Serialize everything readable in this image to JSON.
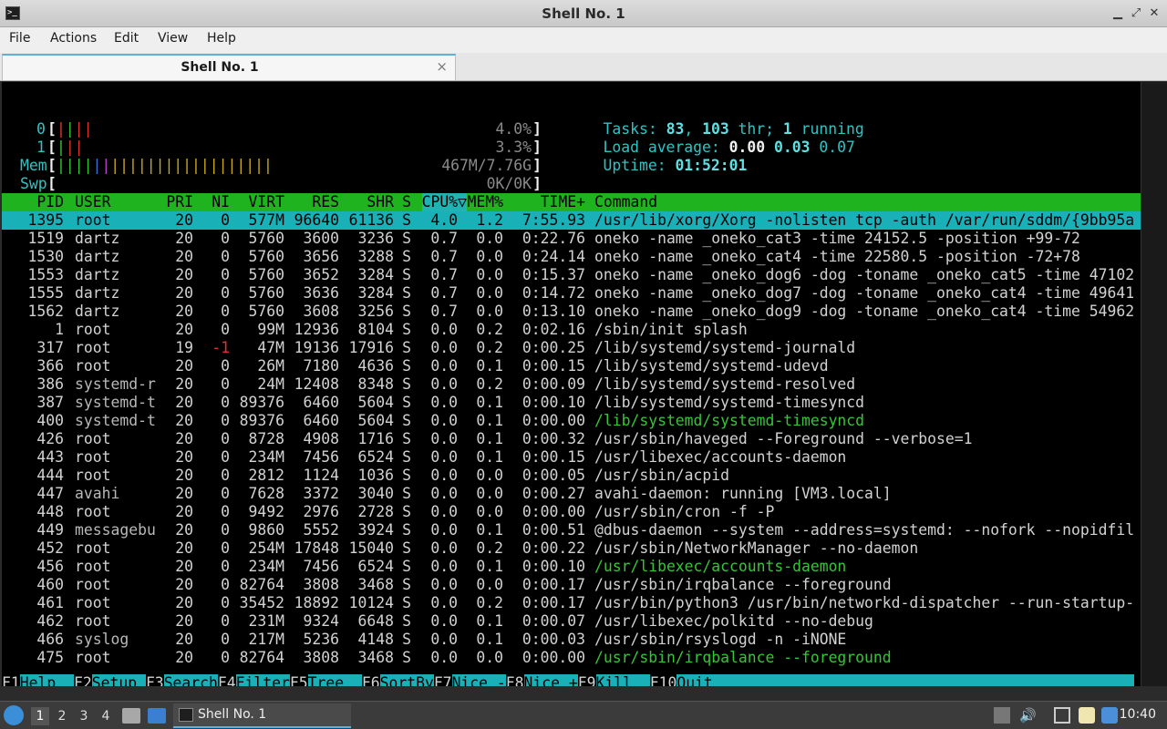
{
  "window": {
    "title": "Shell No. 1"
  },
  "menu": [
    "File",
    "Actions",
    "Edit",
    "View",
    "Help"
  ],
  "tab": {
    "label": "Shell No. 1",
    "close": "×"
  },
  "meters": {
    "cpu0": {
      "label": "0",
      "value": "4.0%"
    },
    "cpu1": {
      "label": "1",
      "value": "3.3%"
    },
    "mem": {
      "label": "Mem",
      "value": "467M/7.76G"
    },
    "swp": {
      "label": "Swp",
      "value": "0K/0K"
    }
  },
  "summary": {
    "tasks_label": "Tasks:",
    "tasks": "83",
    "thr": "103",
    "thr_label": "thr;",
    "running": "1",
    "running_label": "running",
    "load_label": "Load average:",
    "load1": "0.00",
    "load5": "0.03",
    "load15": "0.07",
    "uptime_label": "Uptime:",
    "uptime": "01:52:01"
  },
  "columns": [
    "PID",
    "USER",
    "PRI",
    "NI",
    "VIRT",
    "RES",
    "SHR",
    "S",
    "CPU%▽",
    "MEM%",
    "TIME+",
    "Command"
  ],
  "processes": [
    {
      "pid": "1395",
      "user": "root",
      "pri": "20",
      "ni": "0",
      "virt": "577M",
      "res": "96640",
      "shr": "61136",
      "s": "S",
      "cpu": "4.0",
      "mem": "1.2",
      "time": "7:55.93",
      "cmd": "/usr/lib/xorg/Xorg -nolisten tcp -auth /var/run/sddm/{9bb95a"
    },
    {
      "pid": "1519",
      "user": "dartz",
      "pri": "20",
      "ni": "0",
      "virt": "5760",
      "res": "3600",
      "shr": "3236",
      "s": "S",
      "cpu": "0.7",
      "mem": "0.0",
      "time": "0:22.76",
      "cmd": "oneko -name _oneko_cat3 -time 24152.5 -position +99-72"
    },
    {
      "pid": "1530",
      "user": "dartz",
      "pri": "20",
      "ni": "0",
      "virt": "5760",
      "res": "3656",
      "shr": "3288",
      "s": "S",
      "cpu": "0.7",
      "mem": "0.0",
      "time": "0:24.14",
      "cmd": "oneko -name _oneko_cat4 -time 22580.5 -position -72+78"
    },
    {
      "pid": "1553",
      "user": "dartz",
      "pri": "20",
      "ni": "0",
      "virt": "5760",
      "res": "3652",
      "shr": "3284",
      "s": "S",
      "cpu": "0.7",
      "mem": "0.0",
      "time": "0:15.37",
      "cmd": "oneko -name _oneko_dog6 -dog -toname _oneko_cat5 -time 47102"
    },
    {
      "pid": "1555",
      "user": "dartz",
      "pri": "20",
      "ni": "0",
      "virt": "5760",
      "res": "3636",
      "shr": "3284",
      "s": "S",
      "cpu": "0.7",
      "mem": "0.0",
      "time": "0:14.72",
      "cmd": "oneko -name _oneko_dog7 -dog -toname _oneko_cat4 -time 49641"
    },
    {
      "pid": "1562",
      "user": "dartz",
      "pri": "20",
      "ni": "0",
      "virt": "5760",
      "res": "3608",
      "shr": "3256",
      "s": "S",
      "cpu": "0.7",
      "mem": "0.0",
      "time": "0:13.10",
      "cmd": "oneko -name _oneko_dog9 -dog -toname _oneko_cat4 -time 54962"
    },
    {
      "pid": "1",
      "user": "root",
      "pri": "20",
      "ni": "0",
      "virt": "99M",
      "res": "12936",
      "shr": "8104",
      "s": "S",
      "cpu": "0.0",
      "mem": "0.2",
      "time": "0:02.16",
      "cmd": "/sbin/init splash"
    },
    {
      "pid": "317",
      "user": "root",
      "pri": "19",
      "ni": "-1",
      "virt": "47M",
      "res": "19136",
      "shr": "17916",
      "s": "S",
      "cpu": "0.0",
      "mem": "0.2",
      "time": "0:00.25",
      "cmd": "/lib/systemd/systemd-journald"
    },
    {
      "pid": "366",
      "user": "root",
      "pri": "20",
      "ni": "0",
      "virt": "26M",
      "res": "7180",
      "shr": "4636",
      "s": "S",
      "cpu": "0.0",
      "mem": "0.1",
      "time": "0:00.15",
      "cmd": "/lib/systemd/systemd-udevd"
    },
    {
      "pid": "386",
      "user": "systemd-r",
      "pri": "20",
      "ni": "0",
      "virt": "24M",
      "res": "12408",
      "shr": "8348",
      "s": "S",
      "cpu": "0.0",
      "mem": "0.2",
      "time": "0:00.09",
      "cmd": "/lib/systemd/systemd-resolved"
    },
    {
      "pid": "387",
      "user": "systemd-t",
      "pri": "20",
      "ni": "0",
      "virt": "89376",
      "res": "6460",
      "shr": "5604",
      "s": "S",
      "cpu": "0.0",
      "mem": "0.1",
      "time": "0:00.10",
      "cmd": "/lib/systemd/systemd-timesyncd"
    },
    {
      "pid": "400",
      "user": "systemd-t",
      "pri": "20",
      "ni": "0",
      "virt": "89376",
      "res": "6460",
      "shr": "5604",
      "s": "S",
      "cpu": "0.0",
      "mem": "0.1",
      "time": "0:00.00",
      "cmd": "/lib/systemd/systemd-timesyncd",
      "thread": true
    },
    {
      "pid": "426",
      "user": "root",
      "pri": "20",
      "ni": "0",
      "virt": "8728",
      "res": "4908",
      "shr": "1716",
      "s": "S",
      "cpu": "0.0",
      "mem": "0.1",
      "time": "0:00.32",
      "cmd": "/usr/sbin/haveged --Foreground --verbose=1"
    },
    {
      "pid": "443",
      "user": "root",
      "pri": "20",
      "ni": "0",
      "virt": "234M",
      "res": "7456",
      "shr": "6524",
      "s": "S",
      "cpu": "0.0",
      "mem": "0.1",
      "time": "0:00.15",
      "cmd": "/usr/libexec/accounts-daemon"
    },
    {
      "pid": "444",
      "user": "root",
      "pri": "20",
      "ni": "0",
      "virt": "2812",
      "res": "1124",
      "shr": "1036",
      "s": "S",
      "cpu": "0.0",
      "mem": "0.0",
      "time": "0:00.05",
      "cmd": "/usr/sbin/acpid"
    },
    {
      "pid": "447",
      "user": "avahi",
      "pri": "20",
      "ni": "0",
      "virt": "7628",
      "res": "3372",
      "shr": "3040",
      "s": "S",
      "cpu": "0.0",
      "mem": "0.0",
      "time": "0:00.27",
      "cmd": "avahi-daemon: running [VM3.local]"
    },
    {
      "pid": "448",
      "user": "root",
      "pri": "20",
      "ni": "0",
      "virt": "9492",
      "res": "2976",
      "shr": "2728",
      "s": "S",
      "cpu": "0.0",
      "mem": "0.0",
      "time": "0:00.00",
      "cmd": "/usr/sbin/cron -f -P"
    },
    {
      "pid": "449",
      "user": "messagebu",
      "pri": "20",
      "ni": "0",
      "virt": "9860",
      "res": "5552",
      "shr": "3924",
      "s": "S",
      "cpu": "0.0",
      "mem": "0.1",
      "time": "0:00.51",
      "cmd": "@dbus-daemon --system --address=systemd: --nofork --nopidfil"
    },
    {
      "pid": "452",
      "user": "root",
      "pri": "20",
      "ni": "0",
      "virt": "254M",
      "res": "17848",
      "shr": "15040",
      "s": "S",
      "cpu": "0.0",
      "mem": "0.2",
      "time": "0:00.22",
      "cmd": "/usr/sbin/NetworkManager --no-daemon"
    },
    {
      "pid": "456",
      "user": "root",
      "pri": "20",
      "ni": "0",
      "virt": "234M",
      "res": "7456",
      "shr": "6524",
      "s": "S",
      "cpu": "0.0",
      "mem": "0.1",
      "time": "0:00.10",
      "cmd": "/usr/libexec/accounts-daemon",
      "thread": true
    },
    {
      "pid": "460",
      "user": "root",
      "pri": "20",
      "ni": "0",
      "virt": "82764",
      "res": "3808",
      "shr": "3468",
      "s": "S",
      "cpu": "0.0",
      "mem": "0.0",
      "time": "0:00.17",
      "cmd": "/usr/sbin/irqbalance --foreground"
    },
    {
      "pid": "461",
      "user": "root",
      "pri": "20",
      "ni": "0",
      "virt": "35452",
      "res": "18892",
      "shr": "10124",
      "s": "S",
      "cpu": "0.0",
      "mem": "0.2",
      "time": "0:00.17",
      "cmd": "/usr/bin/python3 /usr/bin/networkd-dispatcher --run-startup-"
    },
    {
      "pid": "462",
      "user": "root",
      "pri": "20",
      "ni": "0",
      "virt": "231M",
      "res": "9324",
      "shr": "6648",
      "s": "S",
      "cpu": "0.0",
      "mem": "0.1",
      "time": "0:00.07",
      "cmd": "/usr/libexec/polkitd --no-debug"
    },
    {
      "pid": "466",
      "user": "syslog",
      "pri": "20",
      "ni": "0",
      "virt": "217M",
      "res": "5236",
      "shr": "4148",
      "s": "S",
      "cpu": "0.0",
      "mem": "0.1",
      "time": "0:00.03",
      "cmd": "/usr/sbin/rsyslogd -n -iNONE"
    },
    {
      "pid": "475",
      "user": "root",
      "pri": "20",
      "ni": "0",
      "virt": "82764",
      "res": "3808",
      "shr": "3468",
      "s": "S",
      "cpu": "0.0",
      "mem": "0.0",
      "time": "0:00.00",
      "cmd": "/usr/sbin/irqbalance --foreground",
      "thread": true
    }
  ],
  "fkeys": [
    {
      "key": "F1",
      "label": "Help  "
    },
    {
      "key": "F2",
      "label": "Setup "
    },
    {
      "key": "F3",
      "label": "Search"
    },
    {
      "key": "F4",
      "label": "Filter"
    },
    {
      "key": "F5",
      "label": "Tree  "
    },
    {
      "key": "F6",
      "label": "SortBy"
    },
    {
      "key": "F7",
      "label": "Nice -"
    },
    {
      "key": "F8",
      "label": "Nice +"
    },
    {
      "key": "F9",
      "label": "Kill  "
    },
    {
      "key": "F10",
      "label": "Quit"
    }
  ],
  "panel": {
    "workspaces": [
      "1",
      "2",
      "3",
      "4"
    ],
    "task_label": "Shell No. 1",
    "clock": "10:40"
  },
  "colors": {
    "accent": "#19b0b8",
    "header": "#1fb31f"
  }
}
